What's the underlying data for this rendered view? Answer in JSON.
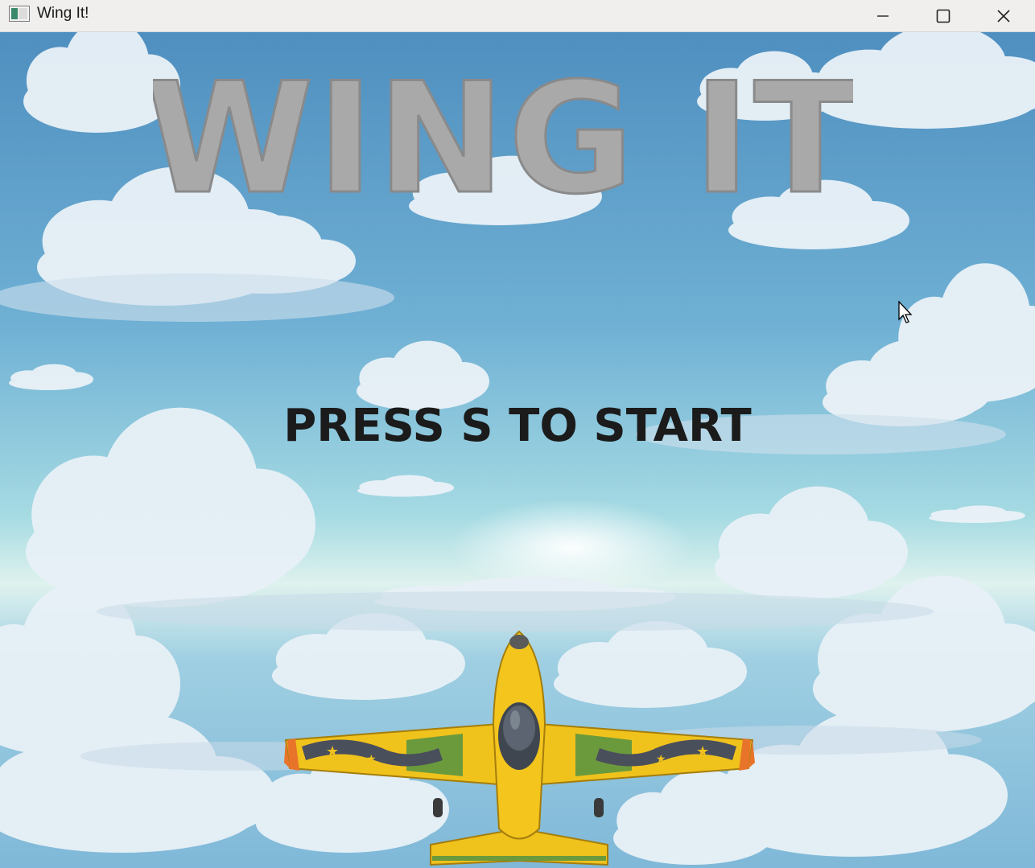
{
  "window": {
    "title": "Wing It!",
    "controls": {
      "minimize_icon": "minimize-icon",
      "maximize_icon": "maximize-icon",
      "close_icon": "close-icon"
    }
  },
  "game": {
    "logo_text": "WING IT",
    "prompt": "PRESS S TO START",
    "colors": {
      "sky_top": "#4f8fc0",
      "sky_horizon": "#bfe6ea",
      "logo_gray": "#a9a9aa",
      "plane_yellow": "#f0c21c",
      "plane_green": "#6b9a3c",
      "plane_orange": "#e8742a",
      "prompt_text": "#1b1b1b"
    }
  }
}
